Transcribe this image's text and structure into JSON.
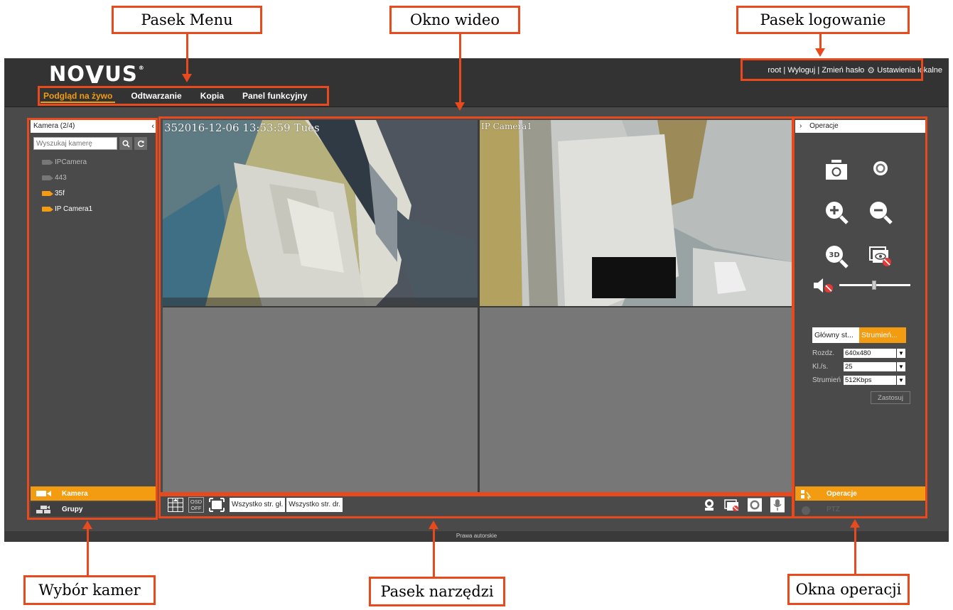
{
  "callouts": {
    "menu_bar": "Pasek Menu",
    "video_window": "Okno wideo",
    "login_bar": "Pasek logowanie",
    "camera_selection": "Wybór kamer",
    "toolbar": "Pasek narzędzi",
    "operations_window": "Okna operacji"
  },
  "app": {
    "logo": {
      "part1": "NO",
      "part2": "V",
      "part3": "US",
      "reg": "®"
    },
    "menu": [
      "Podgląd na żywo",
      "Odtwarzanie",
      "Kopia",
      "Panel funkcyjny"
    ],
    "login": {
      "user": "root",
      "sep": " | ",
      "logout": "Wyloguj",
      "change_password": "Zmień hasło",
      "local_settings": "Ustawienia lokalne"
    },
    "left_panel": {
      "title": "Kamera (2/4)",
      "search_placeholder": "Wyszukaj kamerę",
      "cameras": [
        {
          "name": "IPCamera",
          "online": false
        },
        {
          "name": "443",
          "online": false
        },
        {
          "name": "35f",
          "online": true
        },
        {
          "name": "IP Camera1",
          "online": true
        }
      ],
      "tabs": {
        "camera": "Kamera",
        "groups": "Grupy"
      }
    },
    "video": {
      "tile1_osd": "352016-12-06 13:53:59 Tues",
      "tile2_osd": "IP Camera1"
    },
    "toolbar": {
      "osd_top": "OSD",
      "osd_bottom": "OFF",
      "main_stream_all": "Wszystko str. gł.",
      "sub_stream_all": "Wszystko str. dr."
    },
    "right_panel": {
      "title": "Operacje",
      "main_stream_tab": "Główny st...",
      "sub_stream_tab": "Strumień...",
      "resolution_label": "Rozdz.",
      "resolution_value": "640x480",
      "fps_label": "Kl./s.",
      "fps_value": "25",
      "bitrate_label": "Strumień",
      "bitrate_value": "512Kbps",
      "apply": "Zastosuj",
      "tab_operations": "Operacje",
      "tab_ptz": "PTZ"
    },
    "footer": "Prawa autorskie"
  },
  "colors": {
    "accent": "#f39c12",
    "highlight": "#e8491d",
    "panel": "#4a4a4a",
    "header": "#333333"
  }
}
